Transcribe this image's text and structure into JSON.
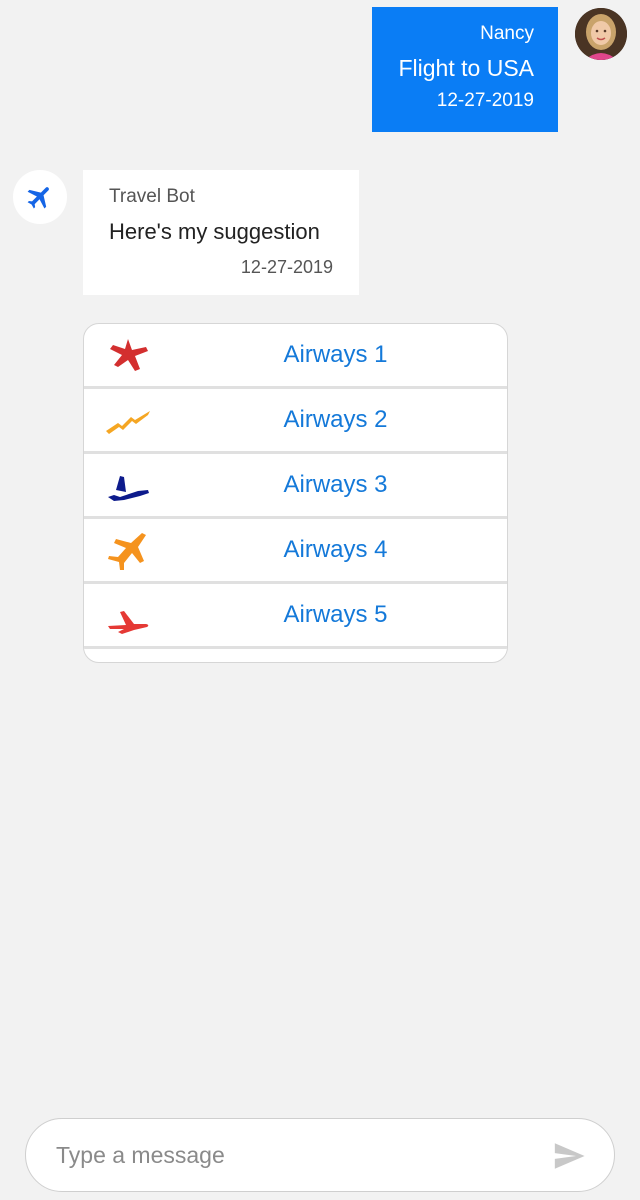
{
  "user_message": {
    "sender": "Nancy",
    "text": "Flight to USA",
    "time": "12-27-2019"
  },
  "bot_message": {
    "sender": "Travel Bot",
    "text": "Here's my suggestion",
    "time": "12-27-2019"
  },
  "suggestions": [
    {
      "label": "Airways 1",
      "icon": "plane-icon",
      "color": "#d32f2f"
    },
    {
      "label": "Airways 2",
      "icon": "plane-icon",
      "color": "#f5a623"
    },
    {
      "label": "Airways 3",
      "icon": "plane-icon",
      "color": "#0d1b8c"
    },
    {
      "label": "Airways 4",
      "icon": "plane-icon",
      "color": "#f5931e"
    },
    {
      "label": "Airways 5",
      "icon": "plane-icon",
      "color": "#e53935"
    }
  ],
  "composer": {
    "placeholder": "Type a message",
    "send_icon": "send-icon"
  },
  "colors": {
    "accent": "#0a7df5",
    "link": "#1479d9",
    "background": "#f2f2f2"
  }
}
